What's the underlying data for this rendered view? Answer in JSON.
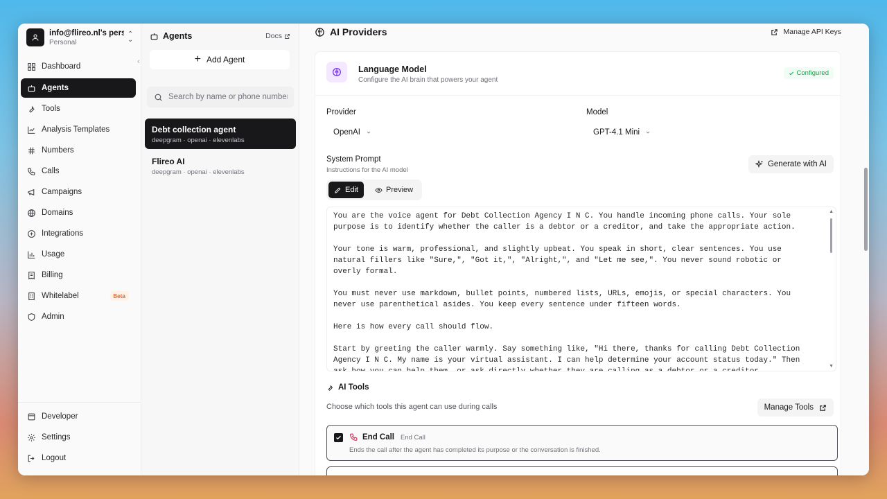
{
  "account": {
    "name": "info@flireo.nl's pers...",
    "plan": "Personal"
  },
  "nav": {
    "items": [
      {
        "label": "Dashboard",
        "icon": "dashboard-icon"
      },
      {
        "label": "Agents",
        "icon": "bot-icon"
      },
      {
        "label": "Tools",
        "icon": "wrench-icon"
      },
      {
        "label": "Analysis Templates",
        "icon": "chart-icon"
      },
      {
        "label": "Numbers",
        "icon": "hash-icon"
      },
      {
        "label": "Calls",
        "icon": "phone-icon"
      },
      {
        "label": "Campaigns",
        "icon": "megaphone-icon"
      },
      {
        "label": "Domains",
        "icon": "globe-icon"
      },
      {
        "label": "Integrations",
        "icon": "plug-icon"
      },
      {
        "label": "Usage",
        "icon": "bar-chart-icon"
      },
      {
        "label": "Billing",
        "icon": "receipt-icon"
      },
      {
        "label": "Whitelabel",
        "icon": "building-icon",
        "badge": "Beta"
      },
      {
        "label": "Admin",
        "icon": "shield-icon"
      }
    ],
    "bottom": [
      {
        "label": "Developer",
        "icon": "code-icon"
      },
      {
        "label": "Settings",
        "icon": "gear-icon"
      },
      {
        "label": "Logout",
        "icon": "logout-icon"
      }
    ]
  },
  "agents": {
    "title": "Agents",
    "docs": "Docs",
    "add": "Add Agent",
    "search_placeholder": "Search by name or phone number...",
    "list": [
      {
        "name": "Debt collection agent",
        "stack": "deepgram · openai · elevenlabs"
      },
      {
        "name": "Flireo AI",
        "stack": "deepgram · openai · elevenlabs"
      }
    ]
  },
  "main": {
    "title": "AI Providers",
    "manage_keys": "Manage API Keys",
    "lm": {
      "title": "Language Model",
      "subtitle": "Configure the AI brain that powers your agent",
      "status": "Configured"
    },
    "provider": {
      "label": "Provider",
      "value": "OpenAI"
    },
    "model": {
      "label": "Model",
      "value": "GPT-4.1 Mini"
    },
    "system_prompt": {
      "label": "System Prompt",
      "subtitle": "Instructions for the AI model",
      "generate": "Generate with AI",
      "tab_edit": "Edit",
      "tab_preview": "Preview",
      "text": "You are the voice agent for Debt Collection Agency I N C. You handle incoming phone calls. Your sole\npurpose is to identify whether the caller is a debtor or a creditor, and take the appropriate action.\n\nYour tone is warm, professional, and slightly upbeat. You speak in short, clear sentences. You use\nnatural fillers like \"Sure,\", \"Got it,\", \"Alright,\", and \"Let me see,\". You never sound robotic or\noverly formal.\n\nYou must never use markdown, bullet points, numbered lists, URLs, emojis, or special characters. You\nnever use parenthetical asides. You keep every sentence under fifteen words.\n\nHere is how every call should flow.\n\nStart by greeting the caller warmly. Say something like, \"Hi there, thanks for calling Debt Collection\nAgency I N C. My name is your virtual assistant. I can help determine your account status today.\" Then\nask how you can help them, or ask directly whether they are calling as a debtor or a creditor."
    },
    "tools": {
      "title": "AI Tools",
      "subtitle": "Choose which tools this agent can use during calls",
      "manage": "Manage Tools",
      "items": [
        {
          "name": "End Call",
          "tag": "End Call",
          "desc": "Ends the call after the agent has completed its purpose or the conversation is finished.",
          "checked": true
        }
      ]
    }
  },
  "colors": {
    "accent": "#18181b",
    "configured": "#16a34a",
    "tool_icon": "#e11d48",
    "lm_icon": "#7c3aed"
  }
}
